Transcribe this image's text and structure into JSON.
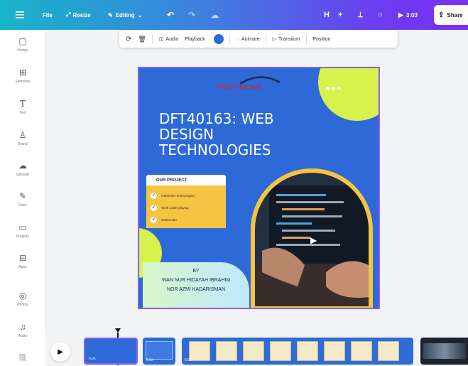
{
  "topbar": {
    "menu_icon": "hamburger-icon",
    "file": "File",
    "resize": "Resize",
    "editing": "Editing",
    "duration": "3:03",
    "share": "Share",
    "avatar_letter": "H",
    "colors": {
      "gradient_start": "#17b5c8",
      "gradient_end": "#7b2ff2"
    }
  },
  "sidebar": {
    "items": [
      {
        "label": "Design",
        "icon": "design-icon"
      },
      {
        "label": "Elements",
        "icon": "elements-icon"
      },
      {
        "label": "Text",
        "icon": "text-icon"
      },
      {
        "label": "Brand",
        "icon": "brand-icon"
      },
      {
        "label": "Uploads",
        "icon": "uploads-icon"
      },
      {
        "label": "Draw",
        "icon": "draw-icon"
      },
      {
        "label": "Projects",
        "icon": "projects-icon"
      },
      {
        "label": "Apps",
        "icon": "apps-icon"
      },
      {
        "label": "Photos",
        "icon": "photos-icon"
      },
      {
        "label": "Audio",
        "icon": "audio-icon"
      }
    ]
  },
  "ctxbar": {
    "audio": "Audio",
    "playback": "Playback",
    "animate": "Animate",
    "transition": "Transition",
    "position": "Position",
    "color_swatch": "#2d6ad8"
  },
  "slide": {
    "logo": "POLITEKNIK",
    "title_lines": [
      "DFT40163: WEB",
      "DESIGN",
      "TECHNOLOGIES"
    ],
    "project_heading": "OUR PROJECT",
    "project_items": [
      "Interactive technologies",
      "Work under playing",
      "Multimedia"
    ],
    "by": "BY",
    "name1": "WAN NUR HIDAYAH IBRAHIM",
    "name2": "NOR AZMI KADARISMAN",
    "colors": {
      "background": "#2d6ad8",
      "accent": "#f6c443",
      "lime": "#d7f24a"
    }
  },
  "timeline": {
    "clip1_label": "6.0s",
    "clip2_label": "5.0s",
    "clip3_label": "5.0s"
  }
}
